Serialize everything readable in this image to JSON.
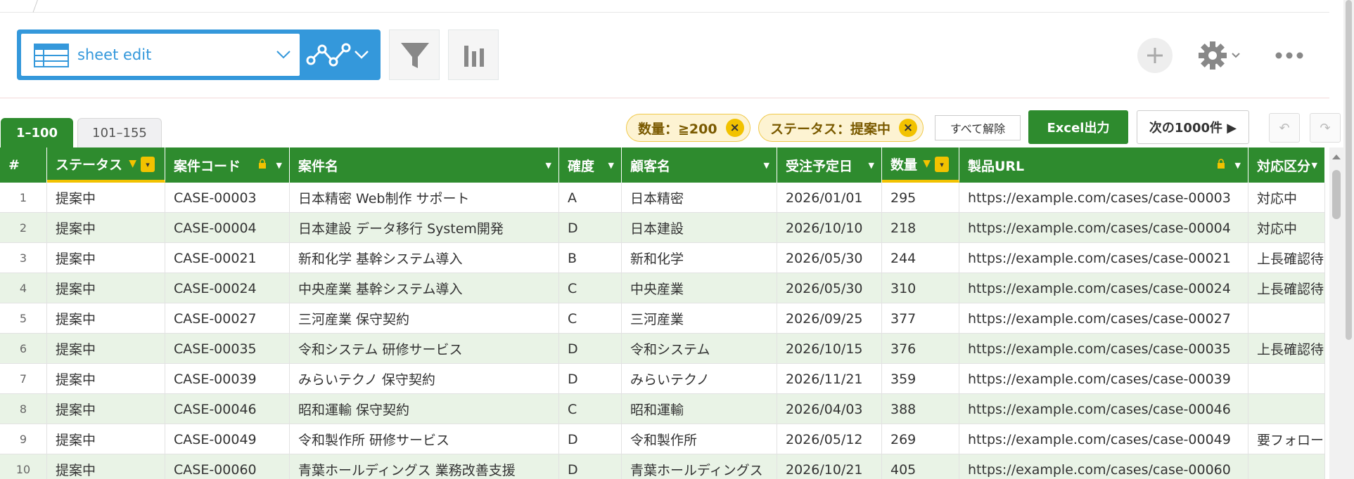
{
  "view_selector": {
    "label": "sheet edit"
  },
  "tabs": [
    {
      "label": "1–100",
      "active": true
    },
    {
      "label": "101–155",
      "active": false
    }
  ],
  "filters": {
    "chips": [
      {
        "label": "数量：≧200"
      },
      {
        "label": "ステータス：提案中"
      }
    ],
    "chip_close": "×",
    "clear_all": "すべて解除"
  },
  "actions": {
    "excel_export": "Excel出力",
    "next_page": "次の1000件 ▶"
  },
  "icons": {
    "plus": "plus-icon",
    "gear": "gear-icon",
    "more": "more-icon",
    "undo": "undo-icon",
    "redo": "redo-icon"
  },
  "columns": [
    {
      "label": "#"
    },
    {
      "label": "ステータス",
      "filtered": true
    },
    {
      "label": "案件コード",
      "locked": true
    },
    {
      "label": "案件名"
    },
    {
      "label": "確度"
    },
    {
      "label": "顧客名"
    },
    {
      "label": "受注予定日"
    },
    {
      "label": "数量",
      "filtered": true
    },
    {
      "label": "製品URL",
      "locked": true
    },
    {
      "label": "対応区分"
    }
  ],
  "rows": [
    [
      "1",
      "提案中",
      "CASE-00003",
      "日本精密 Web制作 サポート",
      "A",
      "日本精密",
      "2026/01/01",
      "295",
      "https://example.com/cases/case-00003",
      "対応中"
    ],
    [
      "2",
      "提案中",
      "CASE-00004",
      "日本建設 データ移行 System開発",
      "D",
      "日本建設",
      "2026/10/10",
      "218",
      "https://example.com/cases/case-00004",
      "対応中"
    ],
    [
      "3",
      "提案中",
      "CASE-00021",
      "新和化学 基幹システム導入",
      "B",
      "新和化学",
      "2026/05/30",
      "244",
      "https://example.com/cases/case-00021",
      "上長確認待"
    ],
    [
      "4",
      "提案中",
      "CASE-00024",
      "中央産業 基幹システム導入",
      "C",
      "中央産業",
      "2026/05/30",
      "310",
      "https://example.com/cases/case-00024",
      "上長確認待"
    ],
    [
      "5",
      "提案中",
      "CASE-00027",
      "三河産業 保守契約",
      "C",
      "三河産業",
      "2026/09/25",
      "377",
      "https://example.com/cases/case-00027",
      ""
    ],
    [
      "6",
      "提案中",
      "CASE-00035",
      "令和システム 研修サービス",
      "D",
      "令和システム",
      "2026/10/15",
      "376",
      "https://example.com/cases/case-00035",
      "上長確認待"
    ],
    [
      "7",
      "提案中",
      "CASE-00039",
      "みらいテクノ 保守契約",
      "D",
      "みらいテクノ",
      "2026/11/21",
      "359",
      "https://example.com/cases/case-00039",
      ""
    ],
    [
      "8",
      "提案中",
      "CASE-00046",
      "昭和運輸 保守契約",
      "C",
      "昭和運輸",
      "2026/04/03",
      "388",
      "https://example.com/cases/case-00046",
      ""
    ],
    [
      "9",
      "提案中",
      "CASE-00049",
      "令和製作所 研修サービス",
      "D",
      "令和製作所",
      "2026/05/12",
      "269",
      "https://example.com/cases/case-00049",
      "要フォロー"
    ],
    [
      "10",
      "提案中",
      "CASE-00060",
      "青葉ホールディングス 業務改善支援",
      "D",
      "青葉ホールディングス",
      "2026/10/21",
      "405",
      "https://example.com/cases/case-00060",
      ""
    ]
  ],
  "colors": {
    "accent_blue": "#3498db",
    "header_green": "#2e8b2e",
    "filter_yellow": "#f2c200",
    "row_alt": "#e9f3e6"
  }
}
